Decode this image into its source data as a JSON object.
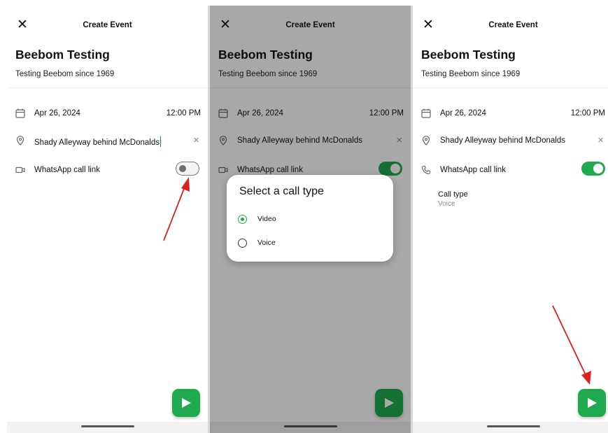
{
  "screens": [
    {
      "close_glyph": "✕",
      "title": "Create Event",
      "event_name": "Beebom Testing",
      "event_desc": "Testing Beebom since 1969",
      "date": "Apr 26, 2024",
      "time": "12:00 PM",
      "location": "Shady Alleyway behind McDonalds",
      "clear_glyph": "×",
      "call_link_label": "WhatsApp call link",
      "toggle_state": "off",
      "call_icon": "video-icon"
    },
    {
      "close_glyph": "✕",
      "title": "Create Event",
      "event_name": "Beebom Testing",
      "event_desc": "Testing Beebom since 1969",
      "date": "Apr 26, 2024",
      "time": "12:00 PM",
      "location": "Shady Alleyway behind McDonalds",
      "clear_glyph": "×",
      "call_link_label": "WhatsApp call link",
      "toggle_state": "on",
      "call_icon": "video-icon",
      "dialog": {
        "title": "Select a call type",
        "options": [
          {
            "label": "Video",
            "selected": true
          },
          {
            "label": "Voice",
            "selected": false
          }
        ]
      }
    },
    {
      "close_glyph": "✕",
      "title": "Create Event",
      "event_name": "Beebom Testing",
      "event_desc": "Testing Beebom since 1969",
      "date": "Apr 26, 2024",
      "time": "12:00 PM",
      "location": "Shady Alleyway behind McDonalds",
      "clear_glyph": "×",
      "call_link_label": "WhatsApp call link",
      "toggle_state": "on",
      "call_icon": "phone-icon",
      "call_type_label": "Call type",
      "call_type_value": "Voice"
    }
  ],
  "colors": {
    "accent_green": "#1faa4e",
    "annotation_red": "#e0201c",
    "overlay": "rgba(0,0,0,0.34)"
  }
}
